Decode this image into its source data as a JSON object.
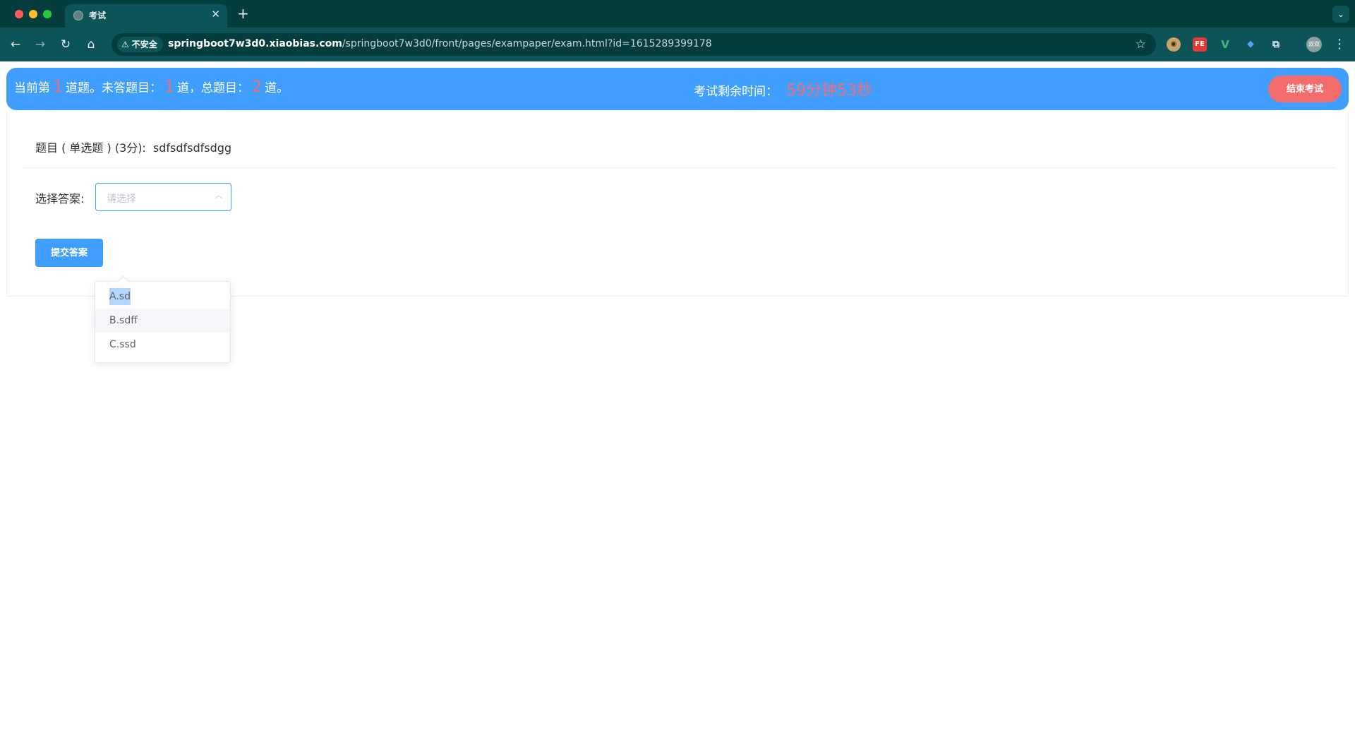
{
  "browser": {
    "tab_title": "考试",
    "url_host": "springboot7w3d0.xiaobias.com",
    "url_path": "/springboot7w3d0/front/pages/exampaper/exam.html?id=1615289399178",
    "security_label": "不安全",
    "profile_label": "双双",
    "extensions": [
      {
        "name": "ext-owl-icon",
        "color": "#c6a36b"
      },
      {
        "name": "ext-fe-icon",
        "label": "FE",
        "color": "#e53935"
      },
      {
        "name": "ext-vue-icon",
        "label": "V",
        "color": "#41b883"
      },
      {
        "name": "ext-pin-icon",
        "color": "#4aa3ff"
      },
      {
        "name": "extensions-puzzle-icon",
        "color": "#e6f2f2"
      }
    ]
  },
  "status": {
    "prefix": "当前第",
    "current": "1",
    "unanswered_text": "道题。未答题目：",
    "unanswered": "1",
    "total_text": "道，总题目：",
    "total": "2",
    "suffix": "道。",
    "time_label": "考试剩余时间：",
    "time_remaining": "59分钟53秒",
    "end_button": "结束考试"
  },
  "question": {
    "header": "题目 ( 单选题 ) (3分):",
    "text": "sdfsdfsdfsdgg",
    "answer_label": "选择答案:",
    "select_placeholder": "请选择",
    "options": [
      "A.sd",
      "B.sdff",
      "C.ssd"
    ],
    "submit_button": "提交答案"
  },
  "colors": {
    "accent": "#409eff",
    "danger": "#f56c6c"
  }
}
